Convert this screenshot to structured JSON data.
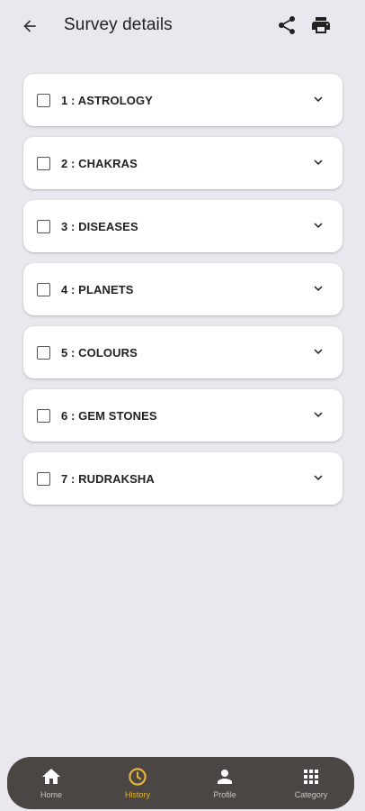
{
  "header": {
    "title": "Survey details",
    "back_icon": "arrow-left-icon",
    "share_icon": "share-icon",
    "print_icon": "print-icon"
  },
  "categories": [
    {
      "label": "1 : ASTROLOGY",
      "checked": false
    },
    {
      "label": "2 : CHAKRAS",
      "checked": false
    },
    {
      "label": "3 : DISEASES",
      "checked": false
    },
    {
      "label": "4 : PLANETS",
      "checked": false
    },
    {
      "label": "5 : COLOURS",
      "checked": false
    },
    {
      "label": "6 : GEM STONES",
      "checked": false
    },
    {
      "label": "7 : RUDRAKSHA",
      "checked": false
    }
  ],
  "bottom_nav": {
    "items": [
      {
        "label": "Home",
        "icon": "home-icon"
      },
      {
        "label": "History",
        "icon": "clock-icon",
        "active": true
      },
      {
        "label": "Profile",
        "icon": "person-icon"
      },
      {
        "label": "Category",
        "icon": "grid-icon"
      }
    ]
  },
  "colors": {
    "background": "#e9e8ee",
    "card": "#ffffff",
    "nav_bar": "#4b4543",
    "nav_active": "#e2b53a",
    "nav_inactive": "#c9c5c3"
  }
}
